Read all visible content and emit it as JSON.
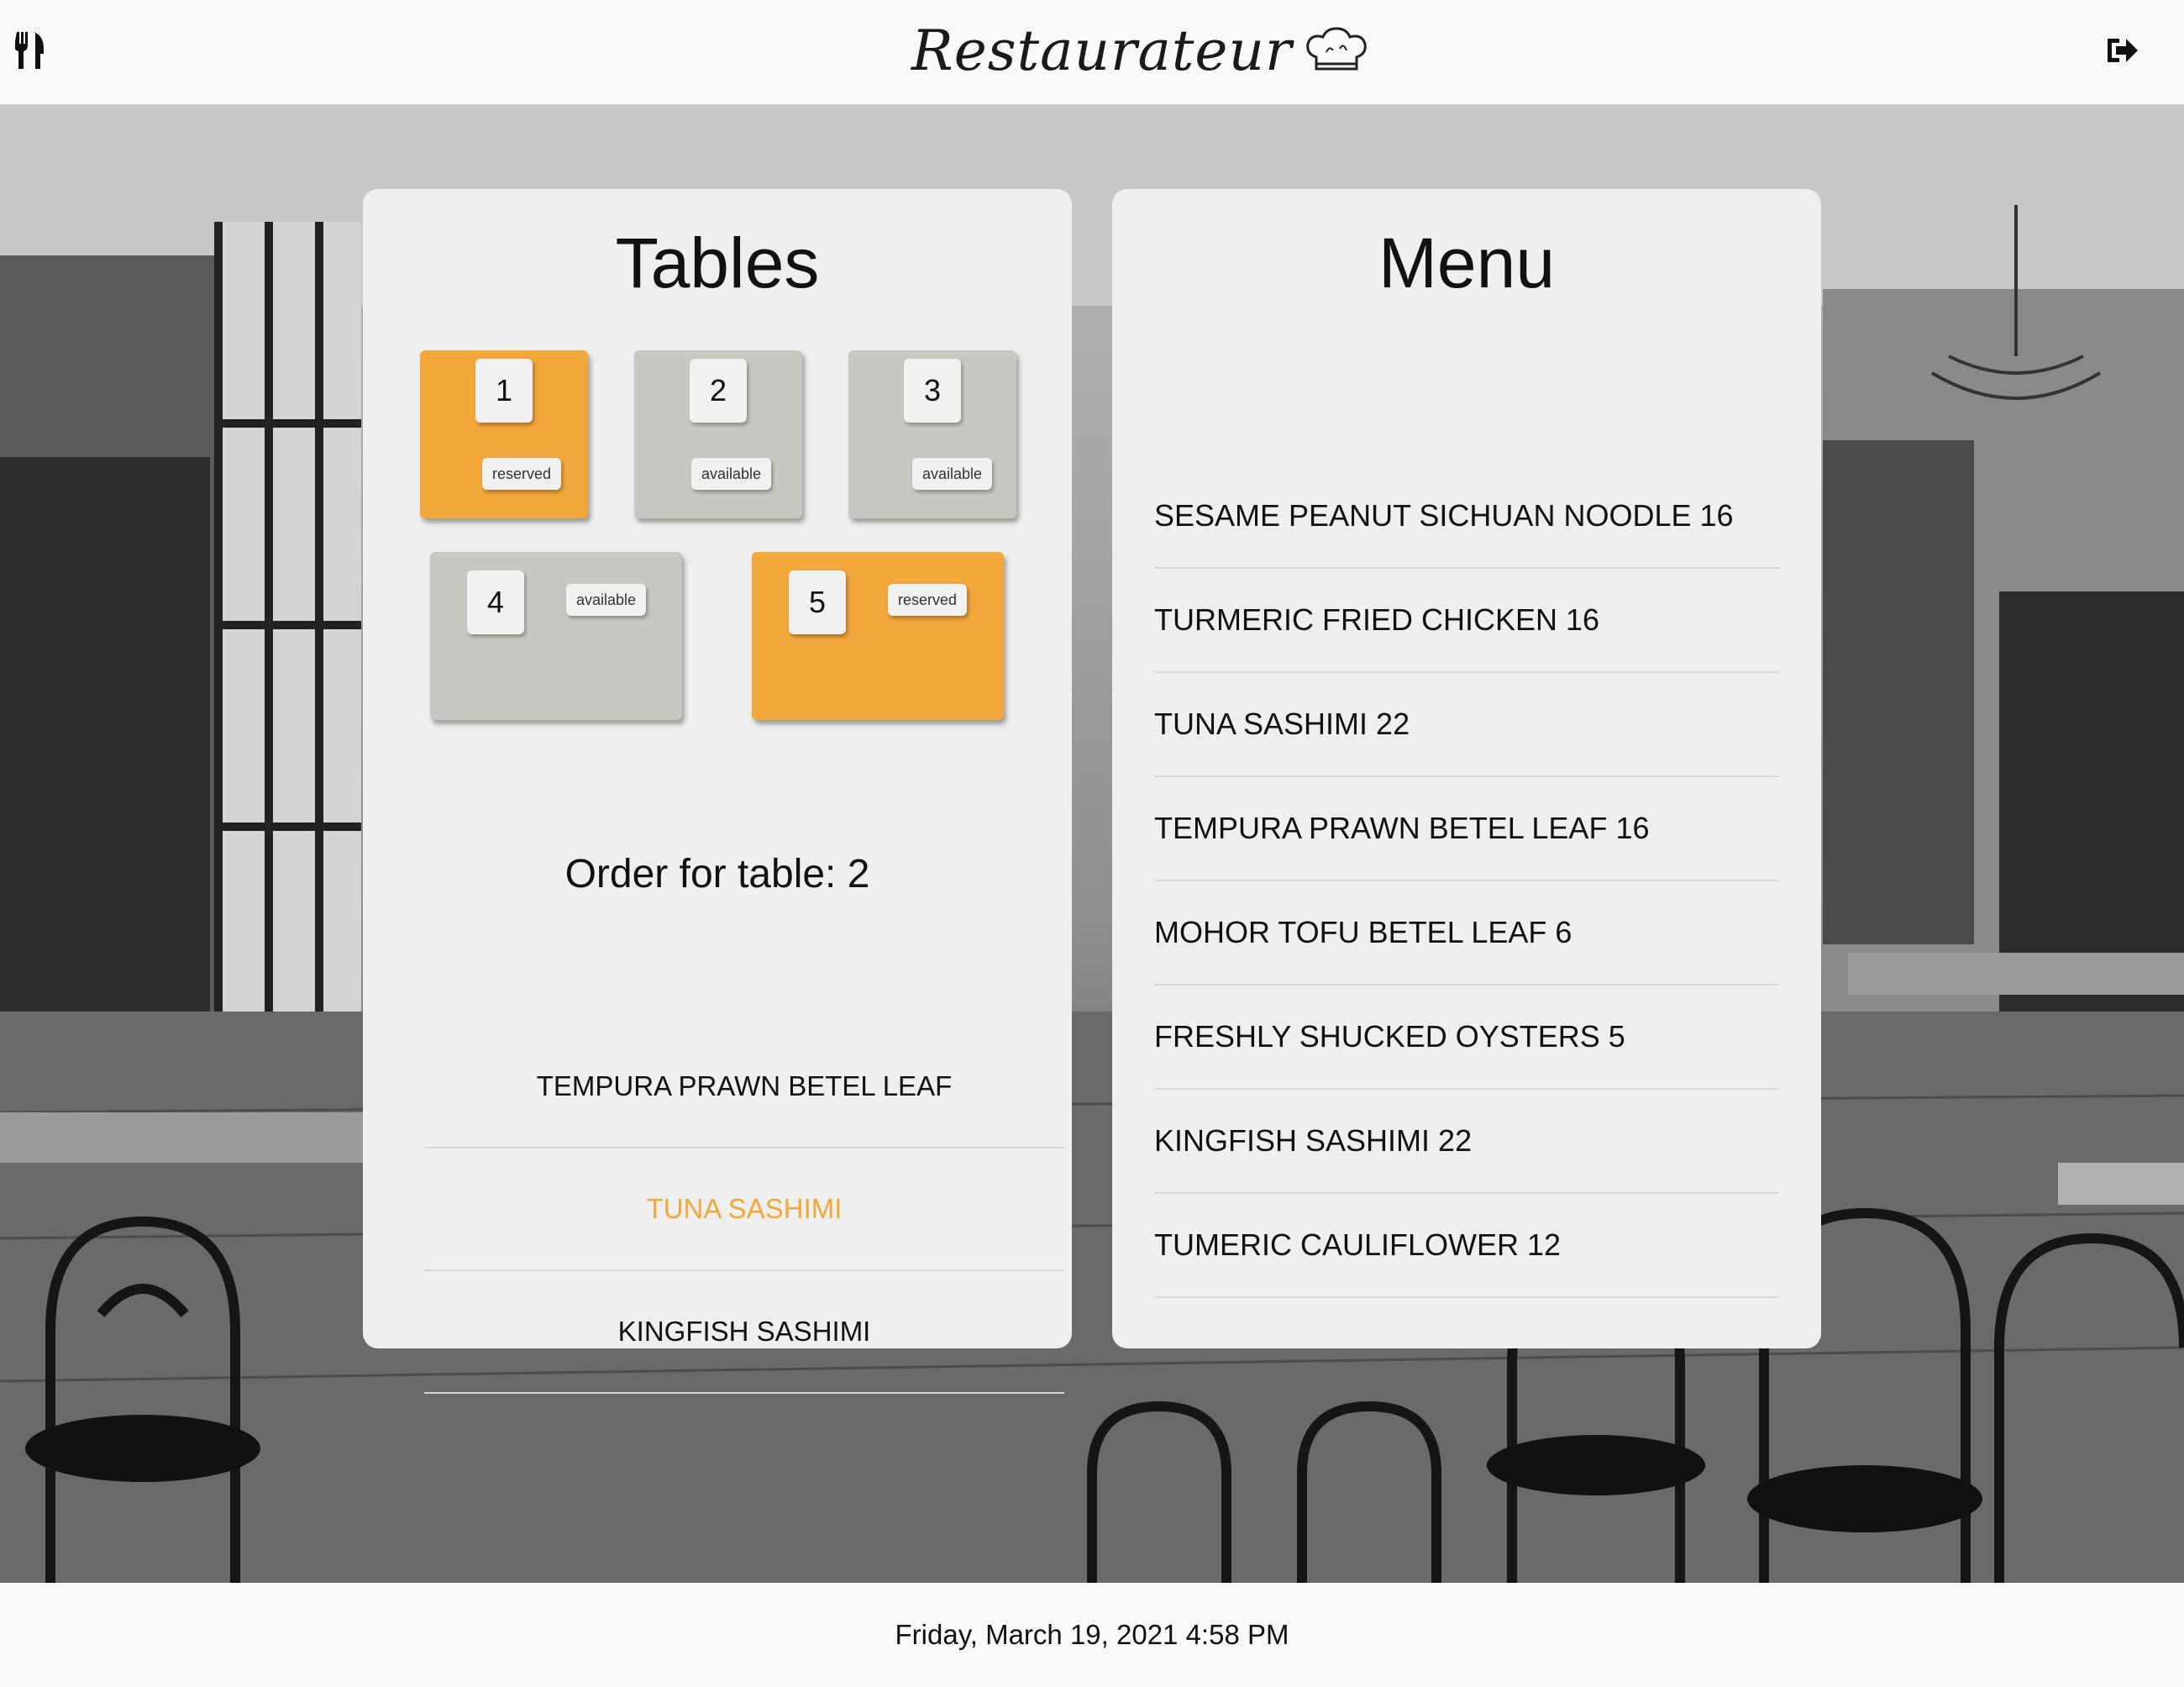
{
  "header": {
    "brand": "Restaurateur",
    "left_icon": "utensils-icon",
    "right_icon": "logout-icon",
    "logo_icon": "chef-hat-icon"
  },
  "tables_panel": {
    "title": "Tables",
    "tables": [
      {
        "number": "1",
        "status": "reserved"
      },
      {
        "number": "2",
        "status": "available"
      },
      {
        "number": "3",
        "status": "available"
      },
      {
        "number": "4",
        "status": "available"
      },
      {
        "number": "5",
        "status": "reserved"
      }
    ],
    "order_title": "Order for table: 2",
    "order_items": [
      {
        "name": "TEMPURA PRAWN BETEL LEAF",
        "selected": false
      },
      {
        "name": "TUNA SASHIMI",
        "selected": true
      },
      {
        "name": "KINGFISH SASHIMI",
        "selected": false
      }
    ]
  },
  "menu_panel": {
    "title": "Menu",
    "items": [
      "SESAME PEANUT SICHUAN NOODLE 16",
      "TURMERIC FRIED CHICKEN 16",
      "TUNA SASHIMI 22",
      "TEMPURA PRAWN BETEL LEAF 16",
      "MOHOR TOFU BETEL LEAF 6",
      "FRESHLY SHUCKED OYSTERS 5",
      "KINGFISH SASHIMI 22",
      "TUMERIC CAULIFLOWER 12"
    ]
  },
  "footer": {
    "datetime": "Friday, March 19, 2021 4:58 PM"
  },
  "colors": {
    "reserved": "#f2a73b",
    "available": "#c8c8c3",
    "selected_text": "#f2a73b",
    "panel_bg": "#efefef"
  }
}
